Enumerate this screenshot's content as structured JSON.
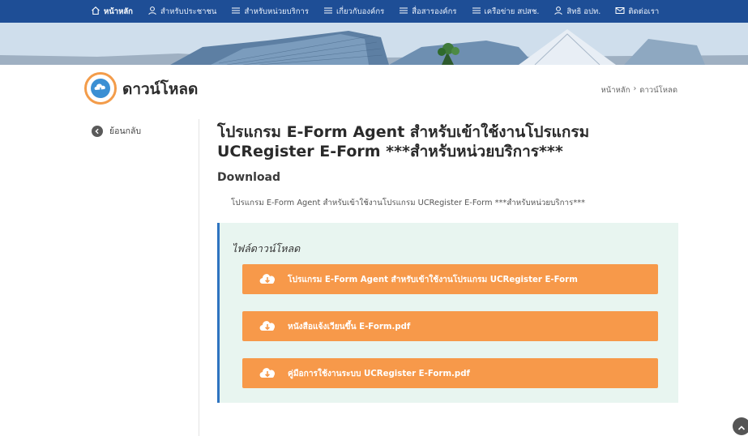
{
  "nav": {
    "items": [
      {
        "label": "หน้าหลัก",
        "icon": "home-icon"
      },
      {
        "label": "สำหรับประชาชน",
        "icon": "person-icon"
      },
      {
        "label": "สำหรับหน่วยบริการ",
        "icon": "list-icon"
      },
      {
        "label": "เกี่ยวกับองค์กร",
        "icon": "list-icon"
      },
      {
        "label": "สื่อสารองค์กร",
        "icon": "list-icon"
      },
      {
        "label": "เครือข่าย สปสช.",
        "icon": "list-icon"
      },
      {
        "label": "สิทธิ อปท.",
        "icon": "person-icon"
      },
      {
        "label": "ติดต่อเรา",
        "icon": "mail-icon"
      }
    ]
  },
  "header": {
    "title": "ดาวน์โหลด",
    "breadcrumb": {
      "home": "หน้าหลัก",
      "separator": "›",
      "current": "ดาวน์โหลด"
    }
  },
  "sidebar": {
    "back_label": "ย้อนกลับ"
  },
  "content": {
    "title": "โปรแกรม E-Form Agent สำหรับเข้าใช้งานโปรแกรม UCRegister E-Form ***สำหรับหน่วยบริการ***",
    "section_heading": "Download",
    "description": "โปรแกรม E-Form Agent สำหรับเข้าใช้งานโปรแกรม UCRegister E-Form ***สำหรับหน่วยบริการ***",
    "files_heading": "ไฟล์ดาวน์โหลด",
    "files": [
      {
        "label": "โปรแกรม E-Form Agent สำหรับเข้าใช้งานโปรแกรม UCRegister E-Form"
      },
      {
        "label": "หนังสือแจ้งเวียนขึ้น E-Form.pdf"
      },
      {
        "label": "คู่มือการใช้งานระบบ UCRegister E-Form.pdf"
      }
    ]
  },
  "colors": {
    "nav_bg": "#1e4e96",
    "accent_orange": "#f7994a",
    "files_box_bg": "#e8f5f0",
    "files_box_border": "#2f74c0"
  }
}
